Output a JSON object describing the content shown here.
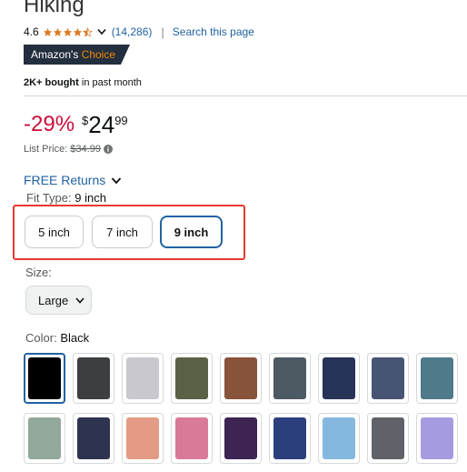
{
  "product": {
    "title_fragment": "Hiking"
  },
  "rating": {
    "value": "4.6",
    "stars": 4.5,
    "count": "(14,286)",
    "separator": "|",
    "search_link": "Search this page",
    "star_color": "#de7921"
  },
  "badge": {
    "prefix": "Amazon's",
    "suffix": "Choice",
    "bg_color": "#232f3e",
    "accent_color": "#f08804"
  },
  "social_proof": {
    "bold": "2K+ bought",
    "rest": "in past month"
  },
  "price": {
    "discount": "-29%",
    "symbol": "$",
    "whole": "24",
    "fraction": "99",
    "list_price_label": "List Price:",
    "list_price": "$34.99",
    "discount_color": "#cc0c39"
  },
  "returns": {
    "label": "FREE Returns"
  },
  "fit_type": {
    "label": "Fit Type:",
    "selected": "9 inch",
    "options": [
      {
        "label": "5 inch",
        "selected": false
      },
      {
        "label": "7 inch",
        "selected": false
      },
      {
        "label": "9 inch",
        "selected": true
      }
    ]
  },
  "size": {
    "label": "Size:",
    "selected": "Large"
  },
  "color": {
    "label": "Color:",
    "selected": "Black",
    "swatches": [
      {
        "hex": "#000000",
        "selected": true
      },
      {
        "hex": "#3d3e42",
        "selected": false
      },
      {
        "hex": "#c9c8ce",
        "selected": false
      },
      {
        "hex": "#5b6147",
        "selected": false
      },
      {
        "hex": "#87533a",
        "selected": false
      },
      {
        "hex": "#4d5a64",
        "selected": false
      },
      {
        "hex": "#273357",
        "selected": false
      },
      {
        "hex": "#485473",
        "selected": false
      },
      {
        "hex": "#4f7a89",
        "selected": false
      },
      {
        "hex": "#92a89b",
        "selected": false
      },
      {
        "hex": "#2e3350",
        "selected": false
      },
      {
        "hex": "#e39b85",
        "selected": false
      },
      {
        "hex": "#d97a98",
        "selected": false
      },
      {
        "hex": "#3d2452",
        "selected": false
      },
      {
        "hex": "#2c3f7d",
        "selected": false
      },
      {
        "hex": "#85b8de",
        "selected": false
      },
      {
        "hex": "#606269",
        "selected": false
      },
      {
        "hex": "#a59be0",
        "selected": false
      }
    ]
  },
  "colors": {
    "link": "#2162a1",
    "highlight_box": "#e53a2f",
    "selected_border": "#2162a1"
  }
}
